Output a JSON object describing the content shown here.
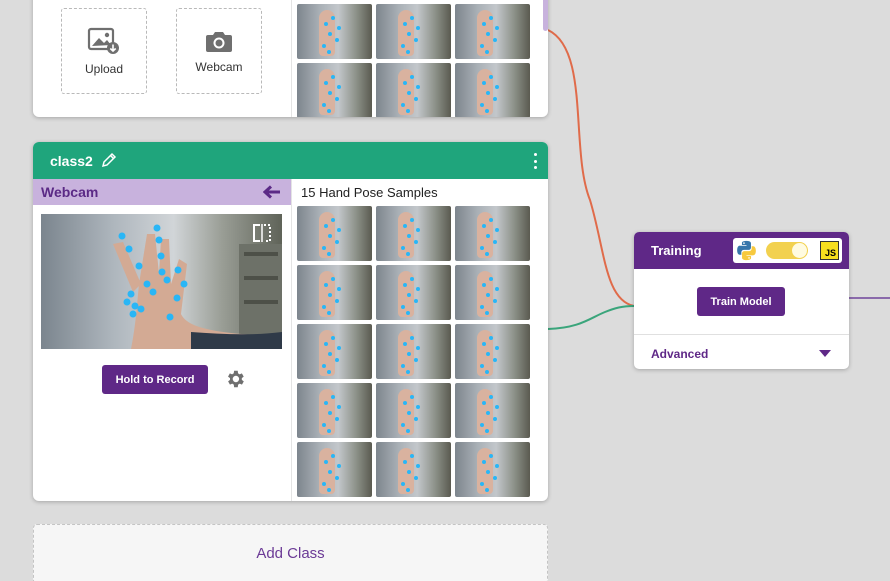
{
  "class1": {
    "upload_label": "Upload",
    "webcam_label": "Webcam",
    "sample_count_visible": 6
  },
  "class2": {
    "name": "class2",
    "webcam_panel_title": "Webcam",
    "samples_title": "15 Hand Pose Samples",
    "sample_count": 15,
    "hold_to_record_label": "Hold to Record"
  },
  "add_class_label": "Add Class",
  "training": {
    "title": "Training",
    "train_button_label": "Train Model",
    "advanced_label": "Advanced",
    "export_toggle_on": true
  },
  "colors": {
    "class_header": "#1fa57c",
    "brand_purple": "#5f2887",
    "webcam_bar": "#c8b2dd",
    "wire_red": "#e06b4a",
    "wire_green": "#3aa57b",
    "wire_purple": "#8a6aab",
    "keypoint": "#29b6f6"
  },
  "icons": {
    "upload": "image-upload-icon",
    "webcam": "camera-icon",
    "edit": "pencil-icon",
    "menu": "kebab-icon",
    "back": "back-arrow-icon",
    "flip": "flip-icon",
    "settings": "gear-icon",
    "python": "python-icon",
    "javascript": "js-icon",
    "expand": "caret-down-icon"
  }
}
